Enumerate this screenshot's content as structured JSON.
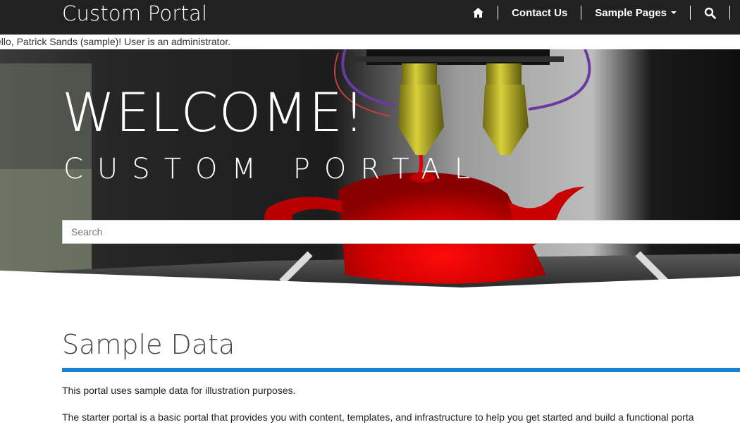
{
  "navbar": {
    "brand": "Custom Portal",
    "items": [
      {
        "label": "Contact Us"
      },
      {
        "label": "Sample Pages"
      }
    ],
    "icons": [
      "home-icon",
      "search-icon"
    ]
  },
  "greeting": "ello, Patrick Sands (sample)! User is an administrator.",
  "hero": {
    "title": "WELCOME!",
    "subtitle": "CUSTOM PORTAL",
    "search_placeholder": "Search"
  },
  "content": {
    "heading": "Sample Data",
    "paragraphs": [
      "This portal uses sample data for illustration purposes.",
      "The starter portal is a basic portal that provides you with content, templates, and infrastructure to help you get started and build a functional porta"
    ]
  },
  "colors": {
    "navbar_bg": "#212121",
    "accent_rule": "#1a82d0",
    "teapot_red": "#d40000"
  }
}
